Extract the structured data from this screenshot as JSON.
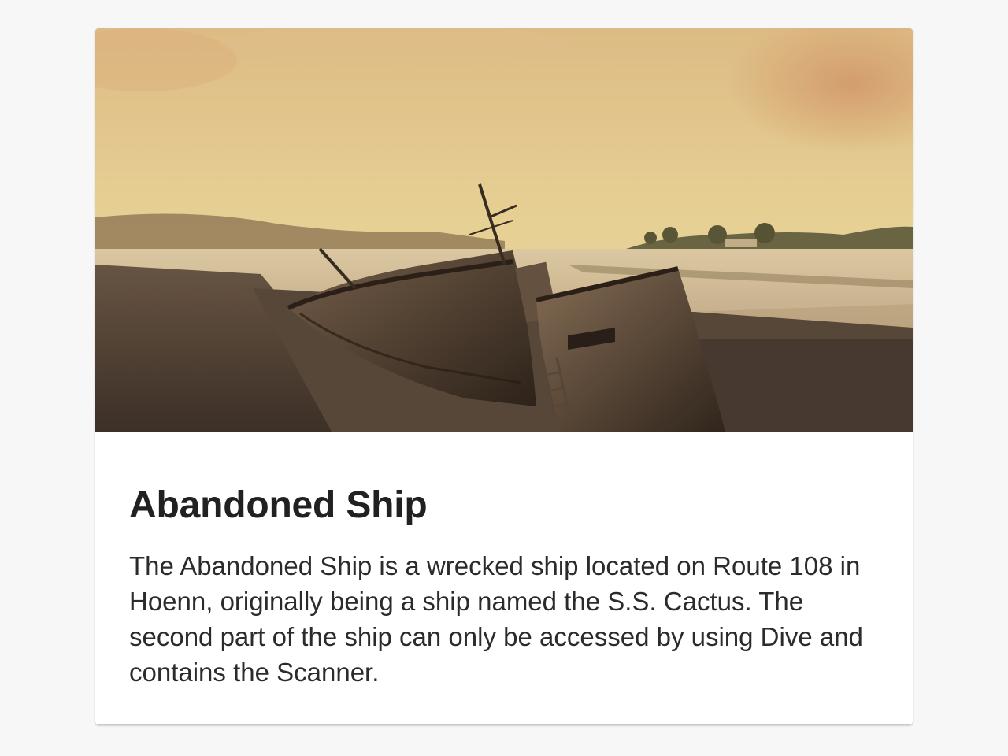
{
  "card": {
    "image": {
      "subject": "wrecked-ship-on-shore",
      "colors": {
        "sky_top": "#e9c98e",
        "sky_bottom": "#f2dd9c",
        "water": "#d9c5a1",
        "shore": "#6d5a49",
        "hull": "#4a3a2c"
      }
    },
    "title": "Abandoned Ship",
    "description": "The Abandoned Ship is a wrecked ship located on Route 108 in Hoenn, originally being a ship named the S.S. Cactus. The second part of the ship can only be accessed by using Dive and contains the Scanner."
  }
}
